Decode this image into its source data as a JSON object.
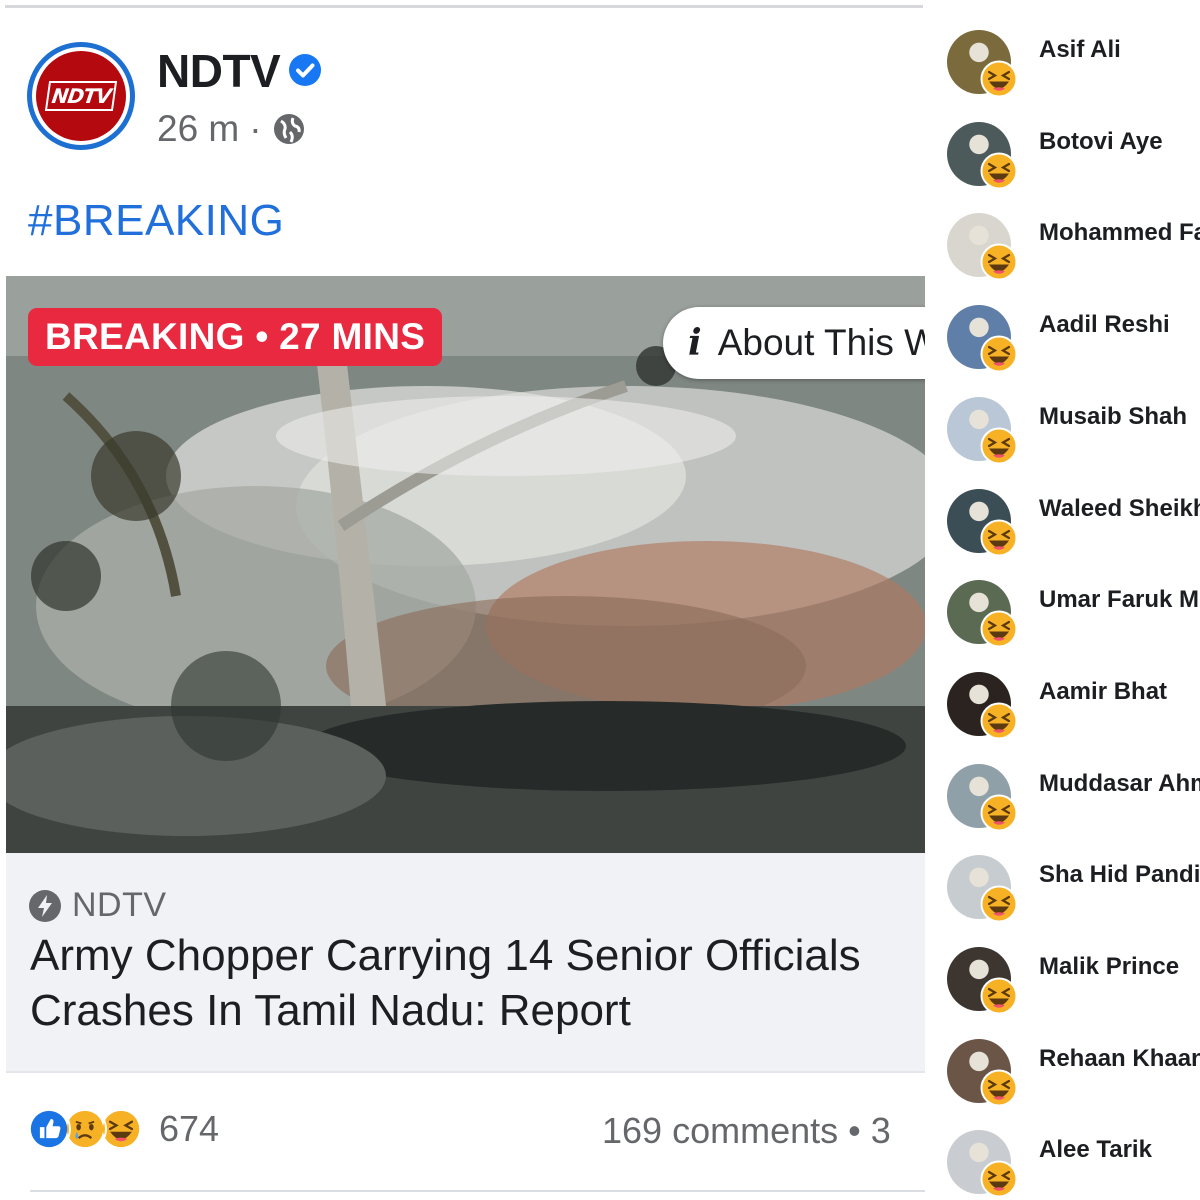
{
  "post": {
    "page_name": "NDTV",
    "logo_text": "NDTV",
    "time": "26 m",
    "separator": "·",
    "hashtag": "#BREAKING",
    "badge": "BREAKING • 27 MINS",
    "about_icon": "i",
    "about_label": "About This W",
    "link_source": "NDTV",
    "headline": "Army Chopper Carrying 14 Senior Officials Crashes In Tamil Nadu: Report",
    "reaction_icons": [
      "like-icon",
      "sad-icon",
      "haha-icon"
    ],
    "reaction_count": "674",
    "comments": "169 comments • 3",
    "colors": {
      "accent": "#216fdb",
      "badge": "#e8293f",
      "logo_red": "#b3090f",
      "verified": "#1877f2"
    }
  },
  "reactors": [
    {
      "name": "Asif Ali",
      "reaction": "haha-icon",
      "avatar_color": "#7a6a3c"
    },
    {
      "name": "Botovi Aye",
      "reaction": "haha-icon",
      "avatar_color": "#4d5a5c"
    },
    {
      "name": "Mohammed Fa",
      "reaction": "haha-icon",
      "avatar_color": "#d9d6cf"
    },
    {
      "name": "Aadil Reshi",
      "reaction": "haha-icon",
      "avatar_color": "#5f7fa8"
    },
    {
      "name": "Musaib Shah",
      "reaction": "haha-icon",
      "avatar_color": "#b9c7d6"
    },
    {
      "name": "Waleed Sheikh",
      "reaction": "haha-icon",
      "avatar_color": "#3b4d55"
    },
    {
      "name": "Umar Faruk Mu",
      "reaction": "haha-icon",
      "avatar_color": "#5b6a52"
    },
    {
      "name": "Aamir Bhat",
      "reaction": "haha-icon",
      "avatar_color": "#2a2320"
    },
    {
      "name": "Muddasar Ahm",
      "reaction": "haha-icon",
      "avatar_color": "#8fa0a8"
    },
    {
      "name": "Sha Hid Pandit",
      "reaction": "haha-icon",
      "avatar_color": "#c7ccd0"
    },
    {
      "name": "Malik Prince",
      "reaction": "haha-icon",
      "avatar_color": "#3d3530"
    },
    {
      "name": "Rehaan Khaan",
      "reaction": "haha-icon",
      "avatar_color": "#6b5546"
    },
    {
      "name": "Alee Tarik",
      "reaction": "haha-icon",
      "avatar_color": "#c9ccd1"
    }
  ]
}
